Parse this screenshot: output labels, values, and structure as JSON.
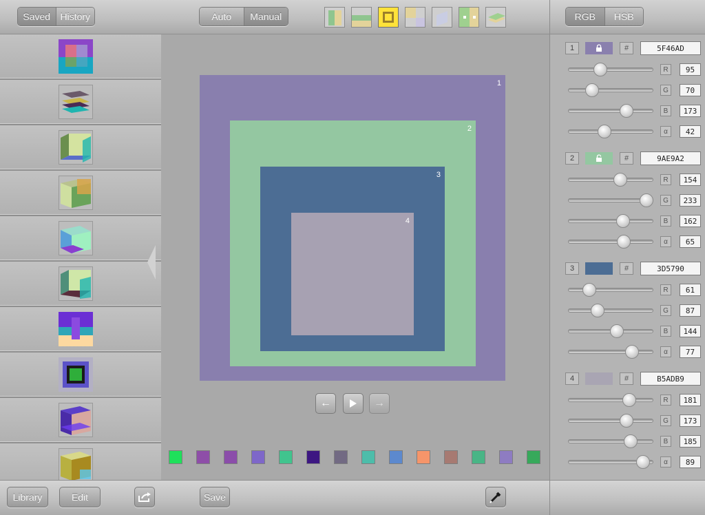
{
  "left": {
    "tabs": [
      "Saved",
      "History"
    ],
    "bottom": {
      "library_label": "Library",
      "edit_label": "Edit"
    }
  },
  "center": {
    "mode_tabs": [
      "Auto",
      "Manual"
    ],
    "layouts": [
      "layout-vertical-split-icon",
      "layout-horizontal-band-icon",
      "layout-nested-squares-icon",
      "layout-quadrant-icon",
      "layout-cube-icon",
      "layout-dots-icon",
      "layout-stacked-planes-icon"
    ],
    "squares": [
      {
        "num": "1",
        "color": "#897FAE"
      },
      {
        "num": "2",
        "color": "#94C7A1"
      },
      {
        "num": "3",
        "color": "#4C6D94"
      },
      {
        "num": "4",
        "color": "#A7A1B2"
      }
    ],
    "swatches": [
      "#1FE05B",
      "#8E4EA8",
      "#8B4DAA",
      "#7E67C9",
      "#41C48E",
      "#3D1782",
      "#726A83",
      "#4DBDAA",
      "#5C89CE",
      "#F6956A",
      "#A77A72",
      "#49B586",
      "#8E7CC2",
      "#37A95B"
    ],
    "save_label": "Save"
  },
  "right": {
    "tabs": [
      "RGB",
      "HSB"
    ],
    "colors": [
      {
        "num": "1",
        "hex": "5F46AD",
        "chip": "#8A80AE",
        "locked": true,
        "channels": [
          {
            "label": "R",
            "value": "95",
            "pos": 0.372
          },
          {
            "label": "G",
            "value": "70",
            "pos": 0.275
          },
          {
            "label": "B",
            "value": "173",
            "pos": 0.678
          },
          {
            "label": "α",
            "value": "42",
            "pos": 0.419
          }
        ]
      },
      {
        "num": "2",
        "hex": "9AE9A2",
        "chip": "#94C7A1",
        "locked": false,
        "channels": [
          {
            "label": "R",
            "value": "154",
            "pos": 0.604
          },
          {
            "label": "G",
            "value": "233",
            "pos": 0.914
          },
          {
            "label": "B",
            "value": "162",
            "pos": 0.635
          },
          {
            "label": "α",
            "value": "65",
            "pos": 0.648
          }
        ]
      },
      {
        "num": "3",
        "hex": "3D5790",
        "chip": "#4C6D94",
        "locked": false,
        "channels": [
          {
            "label": "R",
            "value": "61",
            "pos": 0.239
          },
          {
            "label": "G",
            "value": "87",
            "pos": 0.341
          },
          {
            "label": "B",
            "value": "144",
            "pos": 0.565
          },
          {
            "label": "α",
            "value": "77",
            "pos": 0.745
          }
        ]
      },
      {
        "num": "4",
        "hex": "B5ADB9",
        "chip": "#A9A5B3",
        "locked": false,
        "channels": [
          {
            "label": "R",
            "value": "181",
            "pos": 0.71
          },
          {
            "label": "G",
            "value": "173",
            "pos": 0.678
          },
          {
            "label": "B",
            "value": "185",
            "pos": 0.725
          },
          {
            "label": "α",
            "value": "89",
            "pos": 0.87
          }
        ]
      }
    ]
  }
}
